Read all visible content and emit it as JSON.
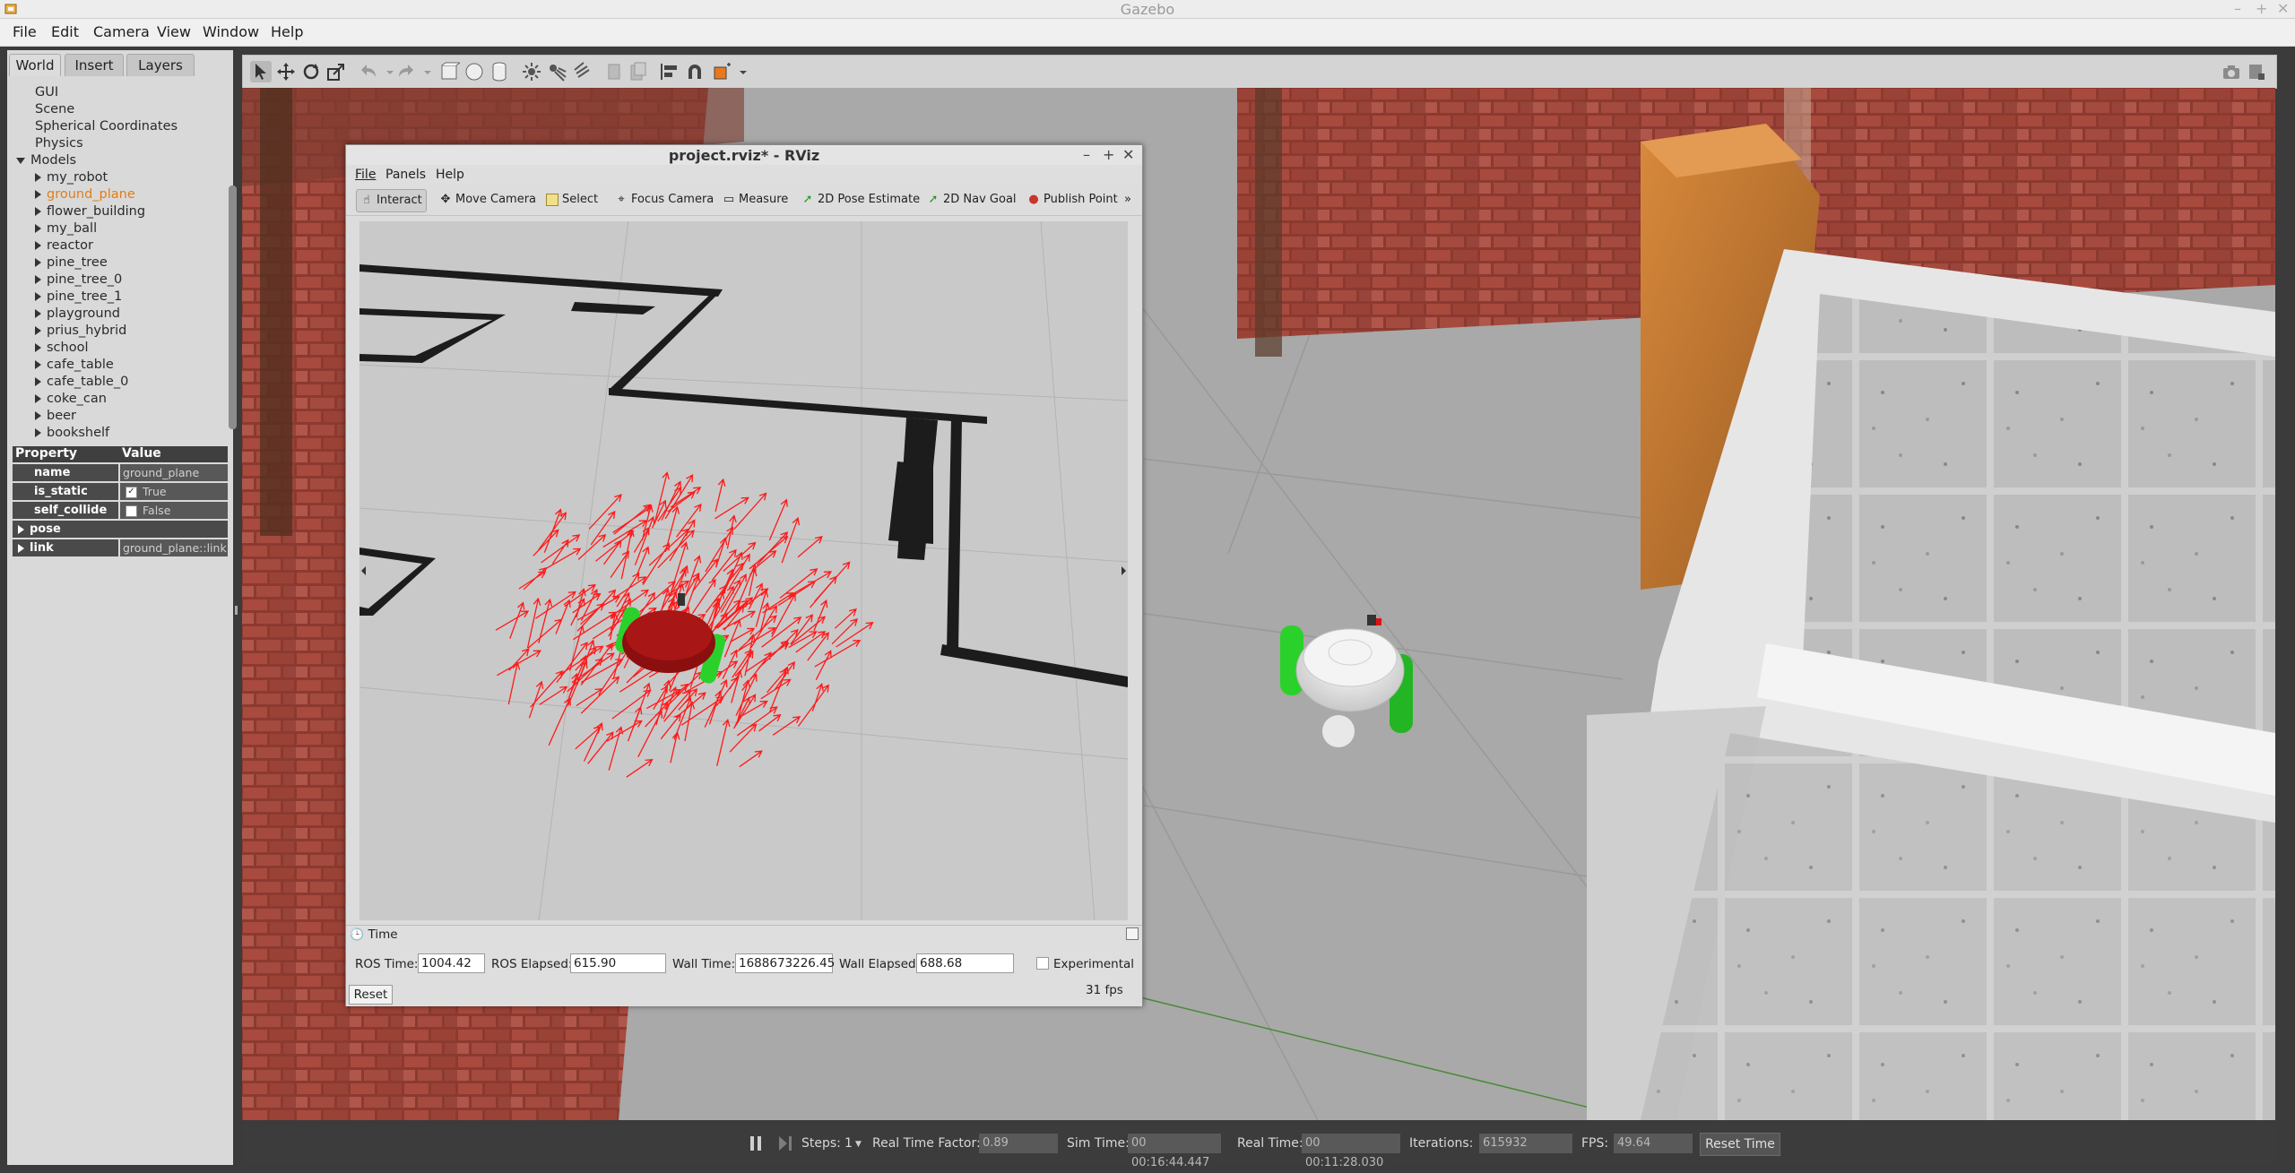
{
  "window": {
    "title": "Gazebo"
  },
  "menu": [
    "File",
    "Edit",
    "Camera",
    "View",
    "Window",
    "Help"
  ],
  "left_tabs": [
    "World",
    "Insert",
    "Layers"
  ],
  "world_tree": {
    "top_items": [
      "GUI",
      "Scene",
      "Spherical Coordinates",
      "Physics"
    ],
    "models_label": "Models",
    "models": [
      "my_robot",
      "ground_plane",
      "flower_building",
      "my_ball",
      "reactor",
      "pine_tree",
      "pine_tree_0",
      "pine_tree_1",
      "playground",
      "prius_hybrid",
      "school",
      "cafe_table",
      "cafe_table_0",
      "coke_can",
      "beer",
      "bookshelf"
    ],
    "selected": "ground_plane"
  },
  "properties": {
    "header_property": "Property",
    "header_value": "Value",
    "rows": [
      {
        "key": "name",
        "value": "ground_plane"
      },
      {
        "key": "is_static",
        "value": "True",
        "checked": true
      },
      {
        "key": "self_collide",
        "value": "False",
        "checked": false
      }
    ],
    "groups": [
      {
        "key": "pose",
        "value": ""
      },
      {
        "key": "link",
        "value": "ground_plane::link"
      }
    ]
  },
  "bottom_bar": {
    "steps_label": "Steps:",
    "steps_value": "1",
    "rtf_label": "Real Time Factor:",
    "rtf_value": "0.89",
    "sim_time_label": "Sim Time:",
    "sim_time_value": "00 00:16:44.447",
    "real_time_label": "Real Time:",
    "real_time_value": "00 00:11:28.030",
    "iterations_label": "Iterations:",
    "iterations_value": "615932",
    "fps_label": "FPS:",
    "fps_value": "49.64",
    "reset_time_label": "Reset Time"
  },
  "rviz": {
    "title": "project.rviz* - RViz",
    "menu": [
      "File",
      "Panels",
      "Help"
    ],
    "tools": [
      "Interact",
      "Move Camera",
      "Select",
      "Focus Camera",
      "Measure",
      "2D Pose Estimate",
      "2D Nav Goal",
      "Publish Point"
    ],
    "more": "»",
    "time_panel": {
      "title": "Time",
      "ros_time_label": "ROS Time:",
      "ros_time_value": "1004.42",
      "ros_elapsed_label": "ROS Elapsed:",
      "ros_elapsed_value": "615.90",
      "wall_time_label": "Wall Time:",
      "wall_time_value": "1688673226.45",
      "wall_elapsed_label": "Wall Elapsed:",
      "wall_elapsed_value": "688.68",
      "experimental_label": "Experimental",
      "reset_label": "Reset",
      "fps_text": "31 fps"
    }
  },
  "colors": {
    "selected_item": "#e37d16",
    "robot_wheels": "#2bd12b",
    "particles": "#ff1a1a"
  }
}
